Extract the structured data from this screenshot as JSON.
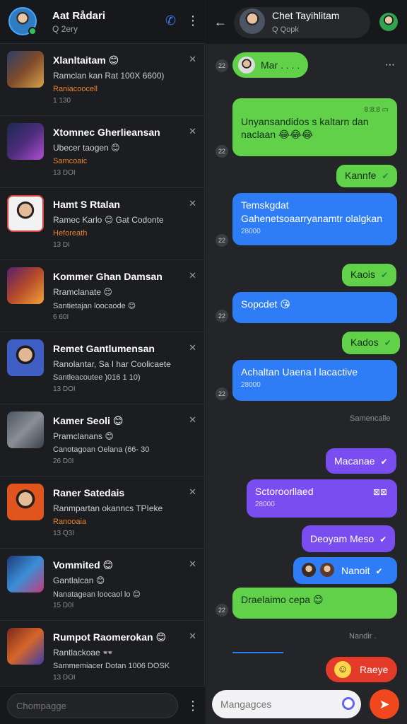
{
  "left": {
    "title": "Aat Rådari",
    "subtitle": "Q 2ery",
    "items": [
      {
        "name": "Xlanltaitam 😊",
        "line1": "Ramclan kan Rat 100X 6600)",
        "line2": "Raniacoocell",
        "meta": "1 130"
      },
      {
        "name": "Xtomnec Gherlieansan",
        "line1": "Ubecer taogen 😊",
        "line2": "Samcoaic",
        "meta": "13 DOI"
      },
      {
        "name": "Hamt S Rtalan",
        "line1": "Ramec Karlo 😊 Gat Codonte",
        "line2": "Heforeath",
        "meta": "13 DI"
      },
      {
        "name": "Kommer Ghan Damsan",
        "line1": "Rramclanate 😊",
        "line2": "Santietajan loocaode 😊",
        "meta": "6 60I"
      },
      {
        "name": "Remet Gantlumensan",
        "line1": "Ranolantar, Sa I har Coolicaete",
        "line2": "Santleacoutee )016 1 10)",
        "meta": "13 DOI"
      },
      {
        "name": "Kamer Seoli 😊",
        "line1": "Pramclanans 😊",
        "line2": "Canotagoan Oelana (66- 30",
        "meta": "26 D0I"
      },
      {
        "name": "Raner Satedais",
        "line1": "Ranmpartan okanncs TPIeke",
        "line2": "Ranooaia",
        "meta": "13 Q3I"
      },
      {
        "name": "Vommited 😊",
        "line1": "Gantlalcan 😊",
        "line2": "Nanatagean loocaol lo 😊",
        "meta": "15 D0I"
      },
      {
        "name": "Rumpot Raomerokan 😊",
        "line1": "Rantlackoae 👓",
        "line2": "Sammemiacer Dotan 1006 DOSK",
        "meta": "13 DOI"
      }
    ],
    "footer_placeholder": "Chompagge"
  },
  "chat": {
    "contact_name": "Chet Tayihlitam",
    "contact_sub": "Q Qopk",
    "pinned": "Mar  .  . . .",
    "messages": [
      {
        "text": "Unyansandidos s kaltarn dan naclaan 😂😂😂",
        "time": "8:8:8 ▭"
      },
      {
        "text": "Kannfe"
      },
      {
        "text": "Temskgdat Gahenetsoaarryanamtr olalgkan",
        "time": "28000"
      },
      {
        "text": "Kaois"
      },
      {
        "text": "Sopcdet 😘"
      },
      {
        "text": "Kados"
      },
      {
        "text": "Achaltan Uaena l lacactive",
        "time": "28000"
      },
      {
        "text": "Macanae"
      },
      {
        "text": "Sctoroorllaed",
        "time": "28000",
        "extra": "⊠⊠"
      },
      {
        "text": "Deoyam Meso"
      },
      {
        "text": "Nanoit"
      },
      {
        "text": "Draelaimo cepa 😊"
      },
      {
        "text": "Raeye"
      }
    ],
    "system_note": "Samencalle",
    "status_note": "Nandir .",
    "ts_label": "22",
    "input_placeholder": "Mangagces"
  }
}
